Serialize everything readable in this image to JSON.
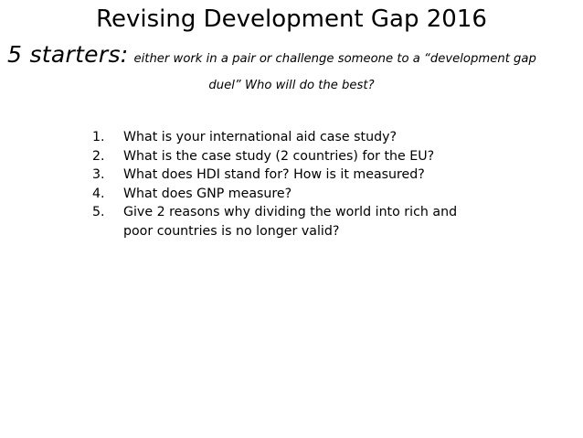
{
  "slide": {
    "title": "Revising Development Gap 2016",
    "subtitle_lead": "5 starters:",
    "subtitle_rest_line1": "either work in a pair or challenge someone to a “development gap",
    "subtitle_rest_line2": "duel” Who will do the best?"
  },
  "questions": [
    {
      "number": "1.",
      "text": "What is your international aid case study?"
    },
    {
      "number": "2.",
      "text": "What is the case study (2 countries) for the EU?"
    },
    {
      "number": "3.",
      "text": "What does HDI stand for? How is it measured?"
    },
    {
      "number": "4.",
      "text": "What does GNP measure?"
    },
    {
      "number": "5.",
      "text": "Give 2 reasons why dividing the world into rich and poor countries is no longer valid?"
    }
  ]
}
